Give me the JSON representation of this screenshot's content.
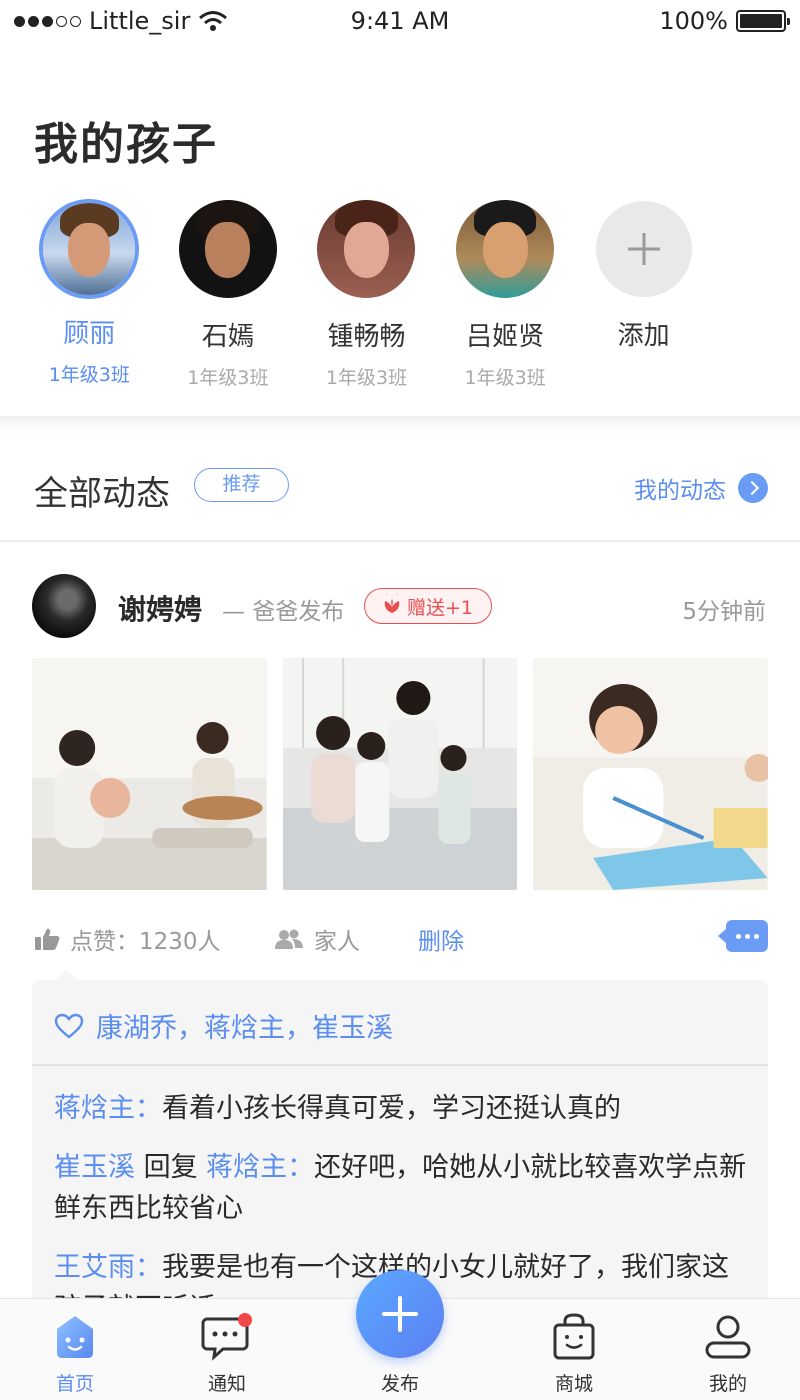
{
  "status_bar": {
    "carrier": "Little_sir",
    "time": "9:41 AM",
    "battery": "100%"
  },
  "page_title": "我的孩子",
  "kids": [
    {
      "name": "顾丽",
      "class": "1年级3班",
      "selected": true
    },
    {
      "name": "石嫣",
      "class": "1年级3班",
      "selected": false
    },
    {
      "name": "锺畅畅",
      "class": "1年级3班",
      "selected": false
    },
    {
      "name": "吕姬贤",
      "class": "1年级3班",
      "selected": false
    }
  ],
  "add_kid_label": "添加",
  "feed": {
    "title": "全部动态",
    "recommend_tag": "推荐",
    "my_activity_label": "我的动态"
  },
  "post": {
    "author": "谢娉娉",
    "role": "— 爸爸发布",
    "gift_label": "赠送+1",
    "time": "5分钟前",
    "photo_icons": [
      "mother-daughter-guitar-photo",
      "family-sofa-photo",
      "girl-drawing-photo"
    ],
    "like_text": "点赞：1230人",
    "visibility": "家人",
    "delete_label": "删除",
    "likers": "康湖乔，蒋焓主，崔玉溪",
    "comments": [
      {
        "user": "蒋焓主：",
        "reply_word": "",
        "reply_to": "",
        "text": "看着小孩长得真可爱，学习还挺认真的"
      },
      {
        "user": "崔玉溪",
        "reply_word": " 回复 ",
        "reply_to": "蒋焓主：",
        "text": "还好吧，哈她从小就比较喜欢学点新鲜东西比较省心"
      },
      {
        "user": "王艾雨：",
        "reply_word": "",
        "reply_to": "",
        "text": "我要是也有一个这样的小女儿就好了，我们家这孩子就不听话"
      }
    ]
  },
  "tabbar": {
    "home": "首页",
    "notice": "通知",
    "publish": "发布",
    "mall": "商城",
    "mine": "我的"
  },
  "colors": {
    "accent": "#5b8ef0",
    "gift": "#e85050",
    "notification_dot": "#f04848"
  }
}
